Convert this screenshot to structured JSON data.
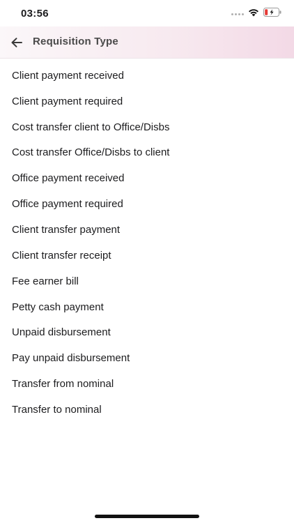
{
  "status_bar": {
    "time": "03:56",
    "icons": [
      "cellular-signal-icon",
      "wifi-icon",
      "battery-low-icon"
    ],
    "battery_color": "#e53935"
  },
  "header": {
    "title": "Requisition Type",
    "back_icon": "arrow-left-icon",
    "gradient_colors": [
      "#fbf7f9",
      "#f3d9e6"
    ]
  },
  "requisition_types": [
    "Client payment received",
    "Client payment required",
    "Cost transfer client to Office/Disbs",
    "Cost transfer Office/Disbs to client",
    "Office payment received",
    "Office payment required",
    "Client transfer payment",
    "Client transfer receipt",
    "Fee earner bill",
    "Petty cash payment",
    "Unpaid disbursement",
    "Pay unpaid disbursement",
    "Transfer from nominal",
    "Transfer to nominal"
  ]
}
